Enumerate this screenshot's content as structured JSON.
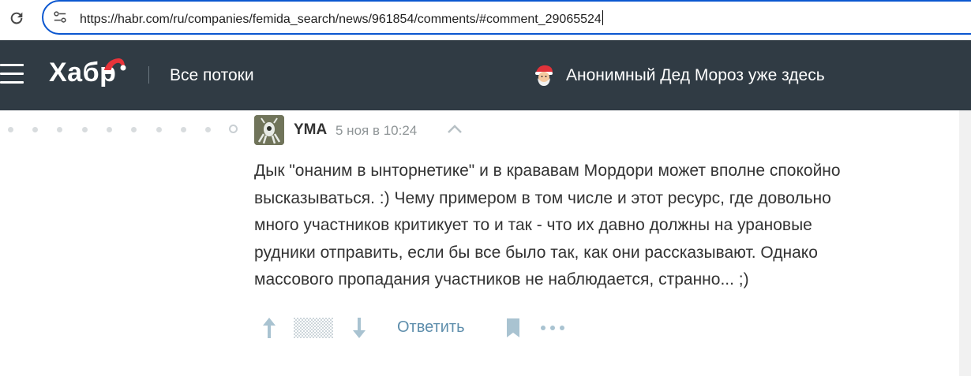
{
  "browser": {
    "url": "https://habr.com/ru/companies/femida_search/news/961854/comments/#comment_29065524"
  },
  "header": {
    "logo": "Хабр",
    "section": "Все потоки",
    "promo": "Анонимный Дед Мороз уже здесь"
  },
  "comment": {
    "author": "YMA",
    "date": "5 ноя в 10:24",
    "lines": [
      "Дык \"онаним в ынторнетике\" и в крававам Мордори может вполне спокойно",
      "высказываться. :) Чему примером в том числе и этот ресурс, где довольно",
      "много участников критикует то и так - что их давно должны на урановые",
      "рудники отправить, если бы все было так, как они рассказывают. Однако",
      "массового пропадания участников не наблюдается, странно... ;)"
    ],
    "reply_label": "Ответить"
  },
  "colors": {
    "header_bg": "#303b44",
    "accent_link": "#5e8eac",
    "omnibox_border": "#0b57d0"
  }
}
